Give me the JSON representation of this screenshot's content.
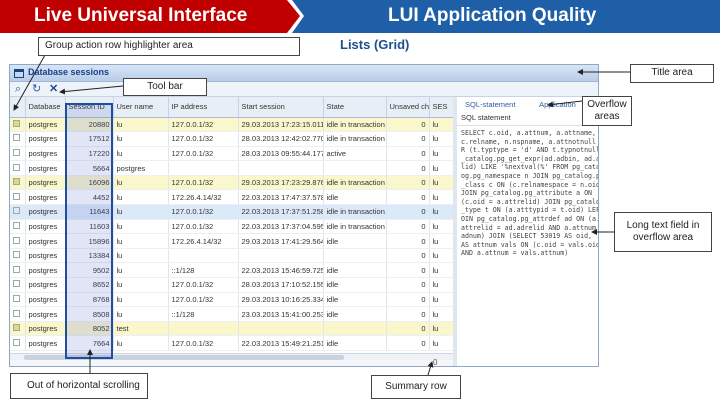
{
  "header": {
    "left_title": "Live Universal Interface",
    "right_title": "LUI Application Quality",
    "subtitle": "Lists (Grid)"
  },
  "callouts": {
    "group_action": "Group action row highlighter area",
    "title_area": "Title area",
    "toolbar": "Tool bar",
    "overflow_area": "Overflow areas",
    "long_text": "Long text field in overflow area",
    "out_of_scroll": "Out of horizontal scrolling",
    "summary_row": "Summary row"
  },
  "window": {
    "title": "Database sessions",
    "summary_value": "0"
  },
  "grid": {
    "columns": [
      "Datаbase",
      "Session ID",
      "User name",
      "IP address",
      "Start session",
      "State",
      "Unsaved changes",
      "SES"
    ],
    "rows": [
      {
        "style": "hl",
        "cells": [
          "postgres",
          "20880",
          "lu",
          "127.0.0.1/32",
          "29.03.2013 17:23:15.011",
          "idle in transaction",
          "0",
          "lu"
        ]
      },
      {
        "style": "",
        "cells": [
          "postgres",
          "17512",
          "lu",
          "127.0.0.1/32",
          "28.03.2013 12:42:02.770",
          "idle in transaction",
          "0",
          "lu"
        ]
      },
      {
        "style": "",
        "cells": [
          "postgres",
          "17220",
          "lu",
          "127.0.0.1/32",
          "28.03.2013 09:55:44.177",
          "active",
          "0",
          "lu"
        ]
      },
      {
        "style": "",
        "cells": [
          "postgres",
          "5664",
          "postgres",
          "",
          "",
          "",
          "0",
          "lu"
        ]
      },
      {
        "style": "hl",
        "cells": [
          "postgres",
          "16096",
          "lu",
          "127.0.0.1/32",
          "29.03.2013 17:23:29.876",
          "idle in transaction",
          "0",
          "lu"
        ]
      },
      {
        "style": "",
        "cells": [
          "postgres",
          "4452",
          "lu",
          "172.26.4.14/32",
          "22.03.2013 17:47:37.578",
          "idle",
          "0",
          "lu"
        ]
      },
      {
        "style": "sel",
        "cells": [
          "postgres",
          "11643",
          "lu",
          "127.0.0.1/32",
          "22.03.2013 17:37:51.258",
          "idle in transaction",
          "0",
          "lu"
        ]
      },
      {
        "style": "",
        "cells": [
          "postgres",
          "11603",
          "lu",
          "127.0.0.1/32",
          "22.03.2013 17:37:04.595",
          "idle in transaction",
          "0",
          "lu"
        ]
      },
      {
        "style": "",
        "cells": [
          "postgres",
          "15896",
          "lu",
          "172.26.4.14/32",
          "29.03.2013 17:41:29.564",
          "idle",
          "0",
          "lu"
        ]
      },
      {
        "style": "",
        "cells": [
          "postgres",
          "13384",
          "lu",
          "",
          "",
          "",
          "0",
          "lu"
        ]
      },
      {
        "style": "",
        "cells": [
          "postgres",
          "9502",
          "lu",
          "::1/128",
          "22.03.2013 15:46:59.725",
          "idle",
          "0",
          "lu"
        ]
      },
      {
        "style": "",
        "cells": [
          "postgres",
          "8652",
          "lu",
          "127.0.0.1/32",
          "28.03.2013 17:10:52.155",
          "idle",
          "0",
          "lu"
        ]
      },
      {
        "style": "",
        "cells": [
          "postgres",
          "8768",
          "lu",
          "127.0.0.1/32",
          "29.03.2013 10:16:25.334",
          "idle",
          "0",
          "lu"
        ]
      },
      {
        "style": "",
        "cells": [
          "postgres",
          "8508",
          "lu",
          "::1/128",
          "23.03.2013 15:41:00.253",
          "idle",
          "0",
          "lu"
        ]
      },
      {
        "style": "hl",
        "cells": [
          "postgres",
          "8052",
          "test",
          "",
          "",
          "",
          "0",
          "lu"
        ]
      },
      {
        "style": "",
        "cells": [
          "postgres",
          "7664",
          "lu",
          "127.0.0.1/32",
          "22.03.2013 15:49:21.251",
          "idle",
          "0",
          "lu"
        ]
      }
    ]
  },
  "overflow": {
    "tab1": "SQL-statement",
    "tab2": "Application",
    "heading": "SQL statement",
    "text": "SELECT c.oid, a.attnum, a.attname,\nc.relname, n.nspname, a.attnotnull O\nR (t.typtype = 'd' AND t.typnotnull), pg\n_catalog.pg_get_expr(ad.adbin, ad.adre\nlid) LIKE '%nextval(%' FROM pg_catal\nog.pg_namespace n JOIN pg_catalog.pg\n_class c ON (c.relnamespace = n.oid)\nJOIN pg_catalog.pg_attribute a ON\n(c.oid = a.attrelid) JOIN pg_catalog.pg\n_type t ON (a.atttypid = t.oid) LEFT J\nOIN pg_catalog.pg_attrdef ad ON (a.\nattrelid = ad.adrelid AND a.attnum = ad.\nadnum) JOIN (SELECT 53019 AS oid,\nAS attnum vals ON (c.oid = vals.oid\nAND a.attnum = vals.attnum)"
  }
}
